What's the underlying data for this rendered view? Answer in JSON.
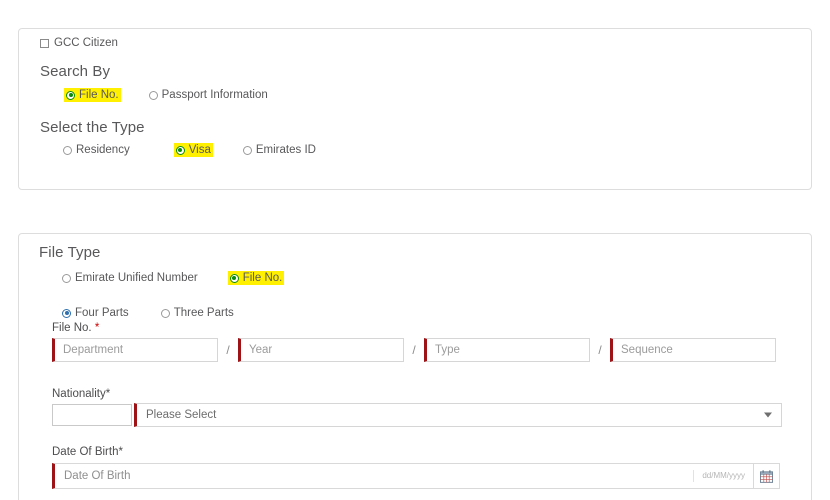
{
  "colors": {
    "highlight": "#ffef00",
    "required_border": "#9e1316",
    "radio_green": "#0a8a0a",
    "radio_blue": "#2f6fad",
    "panel_border": "#dddddd",
    "heading_text": "#58585a",
    "required_star": "#cc0000"
  },
  "search_panel": {
    "gcc_checkbox": {
      "label": "GCC Citizen",
      "checked": false
    },
    "search_by": {
      "heading": "Search By",
      "options": [
        {
          "label": "File No.",
          "selected": true,
          "highlighted": true
        },
        {
          "label": "Passport Information",
          "selected": false,
          "highlighted": false
        }
      ]
    },
    "select_type": {
      "heading": "Select the Type",
      "options": [
        {
          "label": "Residency",
          "selected": false,
          "highlighted": false
        },
        {
          "label": "Visa",
          "selected": true,
          "highlighted": true
        },
        {
          "label": "Emirates ID",
          "selected": false,
          "highlighted": false
        }
      ]
    }
  },
  "file_type_panel": {
    "heading": "File Type",
    "type_options": [
      {
        "label": "Emirate Unified Number",
        "selected": false,
        "highlighted": false
      },
      {
        "label": "File No.",
        "selected": true,
        "highlighted": true
      }
    ],
    "parts_options": [
      {
        "label": "Four Parts",
        "selected": true,
        "highlighted": false
      },
      {
        "label": "Three Parts",
        "selected": false,
        "highlighted": false
      }
    ],
    "file_no": {
      "label": "File No. ",
      "required_mark": "*",
      "separator": "/",
      "fields": [
        {
          "name": "department",
          "placeholder": "Department",
          "value": ""
        },
        {
          "name": "year",
          "placeholder": "Year",
          "value": ""
        },
        {
          "name": "type",
          "placeholder": "Type",
          "value": ""
        },
        {
          "name": "sequence",
          "placeholder": "Sequence",
          "value": ""
        }
      ]
    },
    "nationality": {
      "label": "Nationality*",
      "code_value": "",
      "select_value": "Please Select"
    },
    "date_of_birth": {
      "label": "Date Of Birth*",
      "placeholder": "Date Of Birth",
      "value": "",
      "format_hint": "dd/MM/yyyy",
      "calendar_icon": "calendar-icon"
    }
  }
}
